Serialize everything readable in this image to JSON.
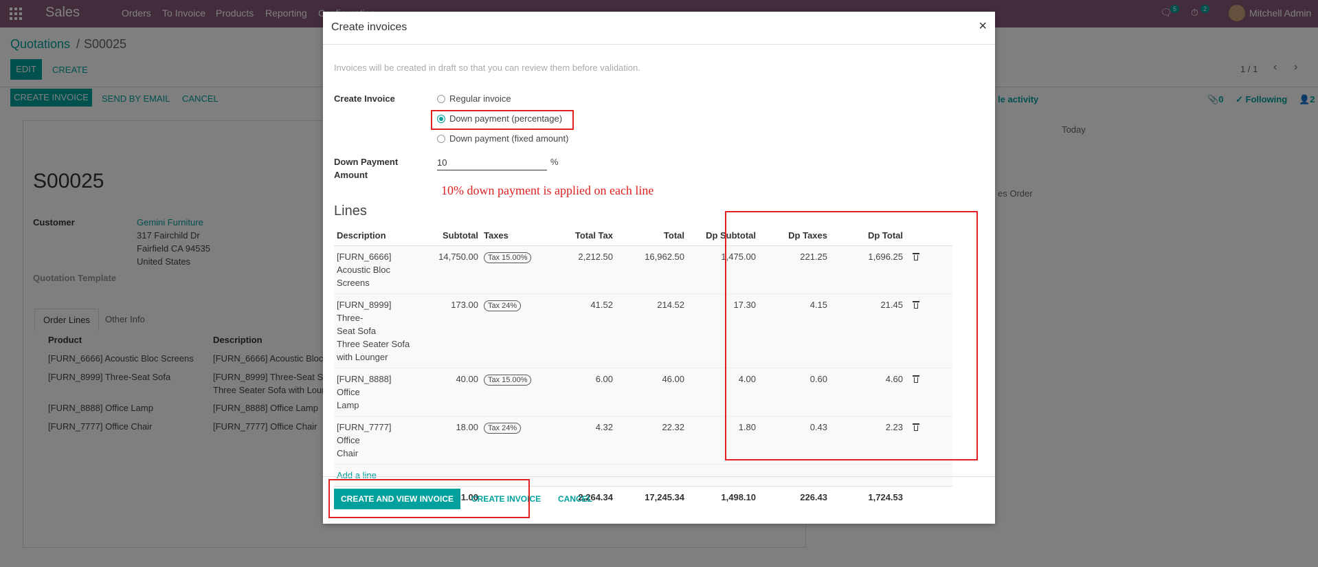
{
  "app": {
    "name": "Sales",
    "menu": [
      "Orders",
      "To Invoice",
      "Products",
      "Reporting",
      "Configuration"
    ],
    "messages_count": "5",
    "activities_count": "2",
    "user": "Mitchell Admin"
  },
  "breadcrumb": {
    "parent": "Quotations",
    "current": "S00025"
  },
  "actions": {
    "edit": "EDIT",
    "create": "CREATE",
    "pager": "1 / 1"
  },
  "statusbar": {
    "create_invoice": "CREATE INVOICE",
    "send_email": "SEND BY EMAIL",
    "cancel": "CANCEL"
  },
  "chatter": {
    "activity": "le activity",
    "attachments": "0",
    "following": "Following",
    "followers": "2",
    "today": "Today",
    "note": "es Order"
  },
  "form": {
    "name": "S00025",
    "customer_label": "Customer",
    "customer_name": "Gemini Furniture",
    "address1": "317 Fairchild Dr",
    "address2": "Fairfield CA 94535",
    "address3": "United States",
    "template_label": "Quotation Template",
    "tabs": [
      "Order Lines",
      "Other Info"
    ],
    "columns": [
      "Product",
      "Description"
    ],
    "rows": [
      {
        "product": "[FURN_6666] Acoustic Bloc Screens",
        "description": "[FURN_6666] Acoustic Bloc",
        "description2": ""
      },
      {
        "product": "[FURN_8999] Three-Seat Sofa",
        "description": "[FURN_8999] Three-Seat So",
        "description2": "Three Seater Sofa with Loun"
      },
      {
        "product": "[FURN_8888] Office Lamp",
        "description": "[FURN_8888] Office Lamp",
        "description2": ""
      },
      {
        "product": "[FURN_7777] Office Chair",
        "description": "[FURN_7777] Office Chair",
        "description2": ""
      }
    ]
  },
  "modal": {
    "title": "Create invoices",
    "close": "×",
    "help": "Invoices will be created in draft so that you can review them before validation.",
    "create_invoice_label": "Create Invoice",
    "options": [
      "Regular invoice",
      "Down payment (percentage)",
      "Down payment (fixed amount)"
    ],
    "selected_option": "Down payment (percentage)",
    "dp_label_1": "Down Payment",
    "dp_label_2": "Amount",
    "dp_value": "10",
    "dp_unit": "%",
    "annotation": "10% down payment is applied on each line",
    "lines_title": "Lines",
    "columns": [
      "Description",
      "Subtotal",
      "Taxes",
      "Total Tax",
      "Total",
      "Dp Subtotal",
      "Dp Taxes",
      "Dp Total"
    ],
    "lines": [
      {
        "desc": [
          "[FURN_6666]",
          "Acoustic Bloc",
          "Screens"
        ],
        "subtotal": "14,750.00",
        "tax": "Tax 15.00%",
        "total_tax": "2,212.50",
        "total": "16,962.50",
        "dp_subtotal": "1,475.00",
        "dp_taxes": "221.25",
        "dp_total": "1,696.25"
      },
      {
        "desc": [
          "[FURN_8999] Three-",
          "Seat Sofa",
          "Three Seater Sofa",
          "with Lounger"
        ],
        "subtotal": "173.00",
        "tax": "Tax 24%",
        "total_tax": "41.52",
        "total": "214.52",
        "dp_subtotal": "17.30",
        "dp_taxes": "4.15",
        "dp_total": "21.45"
      },
      {
        "desc": [
          "[FURN_8888] Office",
          "Lamp"
        ],
        "subtotal": "40.00",
        "tax": "Tax 15.00%",
        "total_tax": "6.00",
        "total": "46.00",
        "dp_subtotal": "4.00",
        "dp_taxes": "0.60",
        "dp_total": "4.60"
      },
      {
        "desc": [
          "[FURN_7777] Office",
          "Chair"
        ],
        "subtotal": "18.00",
        "tax": "Tax 24%",
        "total_tax": "4.32",
        "total": "22.32",
        "dp_subtotal": "1.80",
        "dp_taxes": "0.43",
        "dp_total": "2.23"
      }
    ],
    "add_line": "Add a line",
    "totals": {
      "subtotal": "14,981.00",
      "total_tax": "2,264.34",
      "total": "17,245.34",
      "dp_subtotal": "1,498.10",
      "dp_taxes": "226.43",
      "dp_total": "1,724.53"
    },
    "buttons": {
      "create_view": "CREATE AND VIEW INVOICE",
      "create": "CREATE INVOICE",
      "cancel": "CANCEL"
    }
  },
  "colors": {
    "brand": "#875a7b",
    "accent": "#00a09d",
    "highlight": "#e02020"
  }
}
